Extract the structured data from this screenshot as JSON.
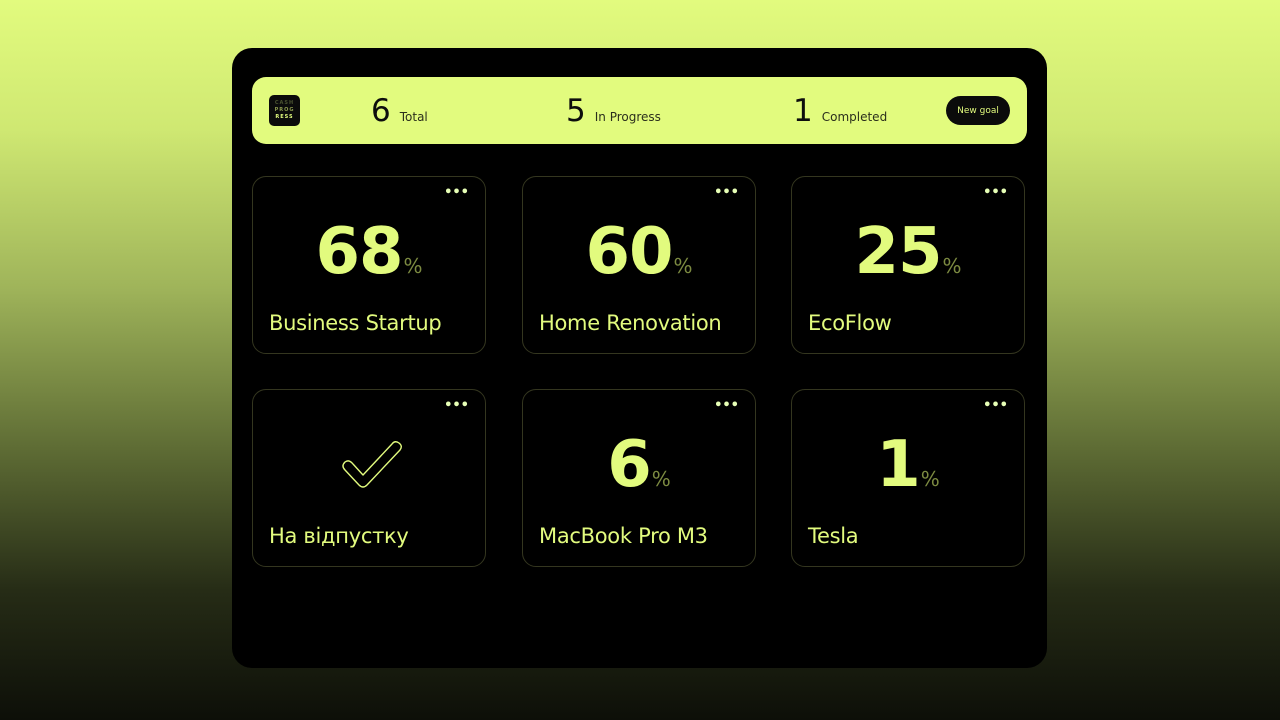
{
  "brand": {
    "logo_lines": [
      "CASH",
      "PROG",
      "RESS"
    ]
  },
  "stats": [
    {
      "value": "6",
      "label": "Total"
    },
    {
      "value": "5",
      "label": "In Progress"
    },
    {
      "value": "1",
      "label": "Completed"
    }
  ],
  "new_goal_label": "New goal",
  "menu_glyph": "•••",
  "percent_sign": "%",
  "goals": [
    {
      "name": "Business Startup",
      "progress": "68",
      "completed": false
    },
    {
      "name": "Home Renovation",
      "progress": "60",
      "completed": false
    },
    {
      "name": "EcoFlow",
      "progress": "25",
      "completed": false
    },
    {
      "name": "На відпустку",
      "progress": null,
      "completed": true,
      "icon": "checkmark-icon"
    },
    {
      "name": "MacBook Pro M3",
      "progress": "6",
      "completed": false
    },
    {
      "name": "Tesla",
      "progress": "1",
      "completed": false
    }
  ],
  "colors": {
    "accent": "#e2fb7e",
    "panel": "#000000",
    "muted_accent": "#7c8a41"
  }
}
